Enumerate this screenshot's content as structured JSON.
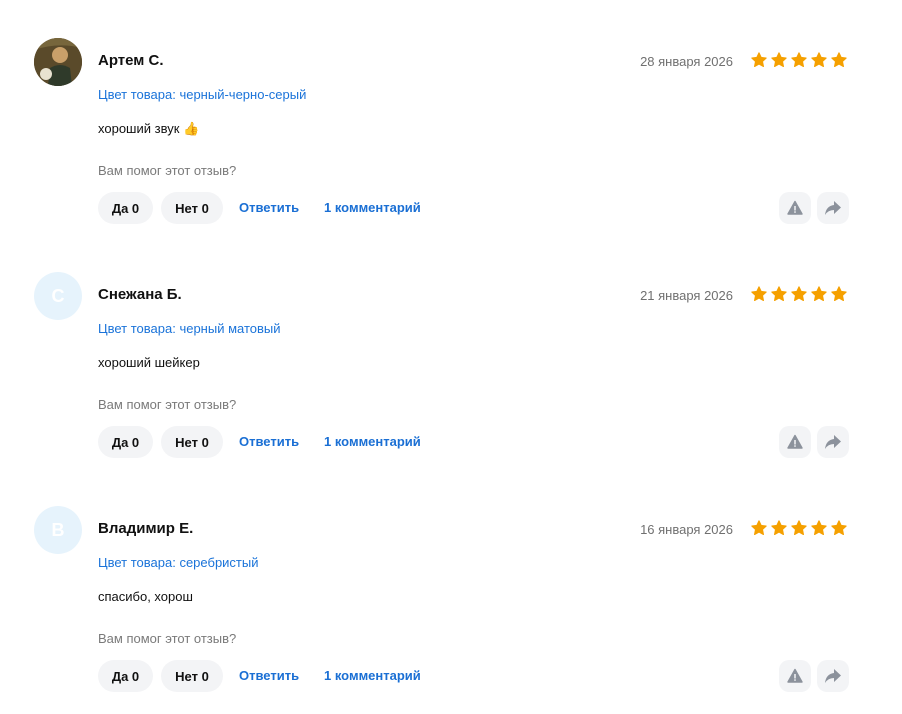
{
  "colors": {
    "star": "#f5a000",
    "link": "#1a6fd4",
    "pill_bg": "#f3f4f6",
    "avatar_letter_bg": "#e6f3fc",
    "icon_gray": "#8c929c"
  },
  "reviews": [
    {
      "author": "Артем С.",
      "avatar": "photo",
      "date": "28 января 2026",
      "rating": 5,
      "variant": "Цвет товара: черный-черно-серый",
      "text": "хороший звук 👍",
      "helpful_question": "Вам помог этот отзыв?",
      "yes_label": "Да 0",
      "no_label": "Нет 0",
      "reply_label": "Ответить",
      "comments_label": "1 комментарий",
      "report_icon": "warning-icon",
      "share_icon": "share-arrow-icon"
    },
    {
      "author": "Снежана Б.",
      "avatar_letter": "С",
      "date": "21 января 2026",
      "rating": 5,
      "variant": "Цвет товара: черный матовый",
      "text": "хороший шейкер",
      "helpful_question": "Вам помог этот отзыв?",
      "yes_label": "Да 0",
      "no_label": "Нет 0",
      "reply_label": "Ответить",
      "comments_label": "1 комментарий",
      "report_icon": "warning-icon",
      "share_icon": "share-arrow-icon"
    },
    {
      "author": "Владимир Е.",
      "avatar_letter": "В",
      "date": "16 января 2026",
      "rating": 5,
      "variant": "Цвет товара: серебристый",
      "text": "спасибо, хорош",
      "helpful_question": "Вам помог этот отзыв?",
      "yes_label": "Да 0",
      "no_label": "Нет 0",
      "reply_label": "Ответить",
      "comments_label": "1 комментарий",
      "report_icon": "warning-icon",
      "share_icon": "share-arrow-icon"
    }
  ]
}
